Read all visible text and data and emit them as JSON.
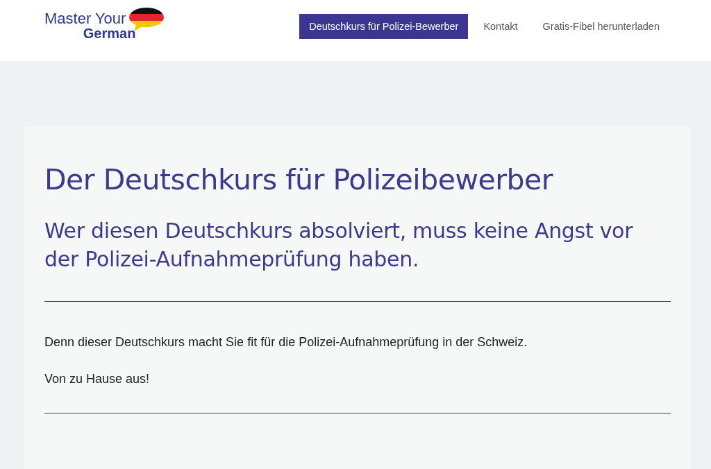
{
  "logo": {
    "line_1": "Master Your",
    "line_2": "German"
  },
  "nav": [
    {
      "label": "Deutschkurs für Polizei-Bewerber",
      "selected": true
    },
    {
      "label": "Kontakt",
      "selected": false
    },
    {
      "label": "Gratis-Fibel herunterladen",
      "selected": false
    }
  ],
  "hero": {
    "title": "Der Deutschkurs für Polizeibewerber",
    "subtitle": "Wer diesen Deutschkurs absolviert, muss keine Angst vor der Polizei-Aufnahmeprüfung haben.",
    "paragraphs": [
      "Denn dieser Deutschkurs macht Sie fit für die Polizei-Aufnahmeprüfung in der Schweiz.",
      "Von zu Hause aus!"
    ]
  }
}
